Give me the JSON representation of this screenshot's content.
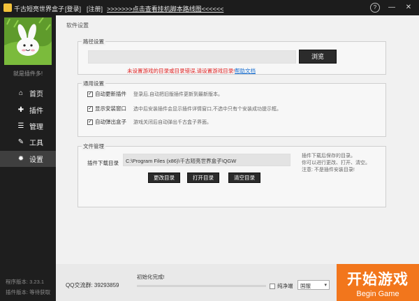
{
  "titlebar": {
    "title": "千古短亮世界盒子",
    "login": "[登录]",
    "register": "[注册]",
    "notice": ">>>>>>>点击查看挂机脚本路线图<<<<<<",
    "help_icon": "question-circle-icon",
    "help_glyph": "?",
    "minimize_glyph": "—",
    "close_glyph": "✕"
  },
  "sidebar": {
    "motto": "就是插件多!",
    "items": [
      {
        "label": "首页",
        "icon": "home-icon",
        "glyph": "⌂",
        "active": false
      },
      {
        "label": "插件",
        "icon": "puzzle-icon",
        "glyph": "✚",
        "active": false
      },
      {
        "label": "管理",
        "icon": "manage-icon",
        "glyph": "☰",
        "active": false
      },
      {
        "label": "工具",
        "icon": "wrench-icon",
        "glyph": "✎",
        "active": false
      },
      {
        "label": "设置",
        "icon": "gear-icon",
        "glyph": "✹",
        "active": true
      }
    ],
    "version": "程序版本: 3.23.1",
    "plugin_version": "插件版本: 等待获取"
  },
  "main": {
    "page_title": "软件设置",
    "path": {
      "title": "路径设置",
      "input_value": "",
      "browse": "浏览",
      "warning": "未设置游戏的目录或目录错误,请设置游戏目录!",
      "help_link": "帮助文档"
    },
    "general": {
      "title": "通用设置",
      "options": [
        {
          "label": "自动更新插件",
          "checked": true,
          "desc": "登录后,自动把旧版插件更新到最新版本。"
        },
        {
          "label": "显示安装窗口",
          "checked": true,
          "desc": "选中后安装插件会显示插件详情窗口,不选中只有个安装成功提示框。"
        },
        {
          "label": "自动弹出盒子",
          "checked": true,
          "desc": "游戏关闭后自动弹出千古盒子界面。"
        }
      ]
    },
    "files": {
      "title": "文件管理",
      "dir_label": "插件下载目录",
      "dir_value": "C:\\Program Files (x86)\\千古短亮世界盒子\\QGW",
      "note_lines": [
        "插件下载后保存的目录。",
        "你可以进行更改、打开、清空。",
        "注意: 不是插件安装目录!"
      ],
      "change": "更改目录",
      "open": "打开目录",
      "clear": "清空目录"
    }
  },
  "bottom": {
    "qq": "QQ交流群: 39293859",
    "init_status": "初始化完成!",
    "progress": 0,
    "pure_label": "纯净端",
    "pure_checked": false,
    "server": "国服",
    "start_zh": "开始游戏",
    "start_en": "Begin Game"
  },
  "colors": {
    "accent": "#f2761c",
    "sidebar_bg": "#1e1e1e",
    "warning": "#e02020",
    "link": "#1a6fd0"
  }
}
